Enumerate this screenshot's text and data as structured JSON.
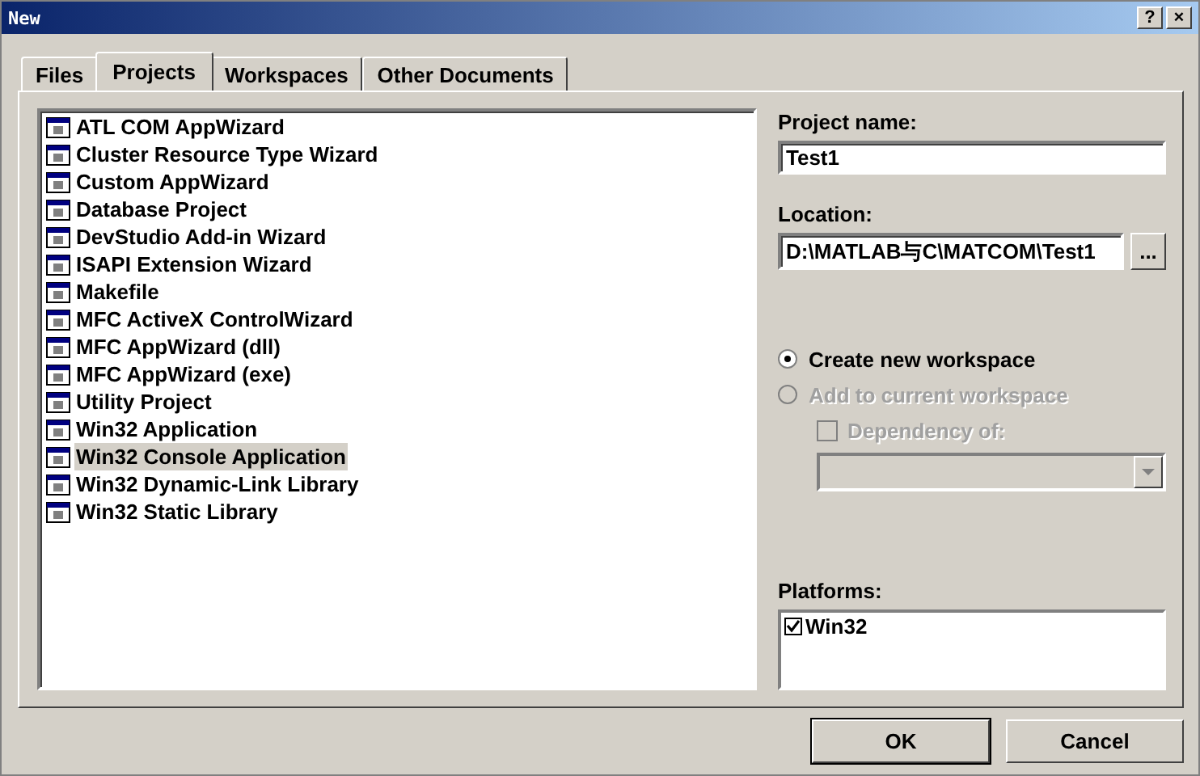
{
  "window": {
    "title": "New",
    "help_button": "?",
    "close_button": "×"
  },
  "tabs": [
    {
      "label": "Files",
      "selected": false
    },
    {
      "label": "Projects",
      "selected": true
    },
    {
      "label": "Workspaces",
      "selected": false
    },
    {
      "label": "Other Documents",
      "selected": false
    }
  ],
  "project_types": [
    {
      "label": "ATL COM AppWizard",
      "selected": false
    },
    {
      "label": "Cluster Resource Type Wizard",
      "selected": false
    },
    {
      "label": "Custom AppWizard",
      "selected": false
    },
    {
      "label": "Database Project",
      "selected": false
    },
    {
      "label": "DevStudio Add-in Wizard",
      "selected": false
    },
    {
      "label": "ISAPI Extension Wizard",
      "selected": false
    },
    {
      "label": "Makefile",
      "selected": false
    },
    {
      "label": "MFC ActiveX ControlWizard",
      "selected": false
    },
    {
      "label": "MFC AppWizard (dll)",
      "selected": false
    },
    {
      "label": "MFC AppWizard (exe)",
      "selected": false
    },
    {
      "label": "Utility Project",
      "selected": false
    },
    {
      "label": "Win32 Application",
      "selected": false
    },
    {
      "label": "Win32 Console Application",
      "selected": true
    },
    {
      "label": "Win32 Dynamic-Link Library",
      "selected": false
    },
    {
      "label": "Win32 Static Library",
      "selected": false
    }
  ],
  "project_name": {
    "label": "Project name:",
    "value": "Test1"
  },
  "location": {
    "label": "Location:",
    "value": "D:\\MATLAB与C\\MATCOM\\Test1",
    "browse_button": "..."
  },
  "workspace_options": [
    {
      "label": "Create new workspace",
      "selected": true,
      "disabled": false
    },
    {
      "label": "Add to current workspace",
      "selected": false,
      "disabled": true
    }
  ],
  "dependency": {
    "label": "Dependency of:",
    "checked": false,
    "disabled": true
  },
  "platforms": {
    "label": "Platforms:",
    "items": [
      {
        "label": "Win32",
        "checked": true
      }
    ]
  },
  "buttons": [
    {
      "label": "OK"
    },
    {
      "label": "Cancel"
    }
  ]
}
